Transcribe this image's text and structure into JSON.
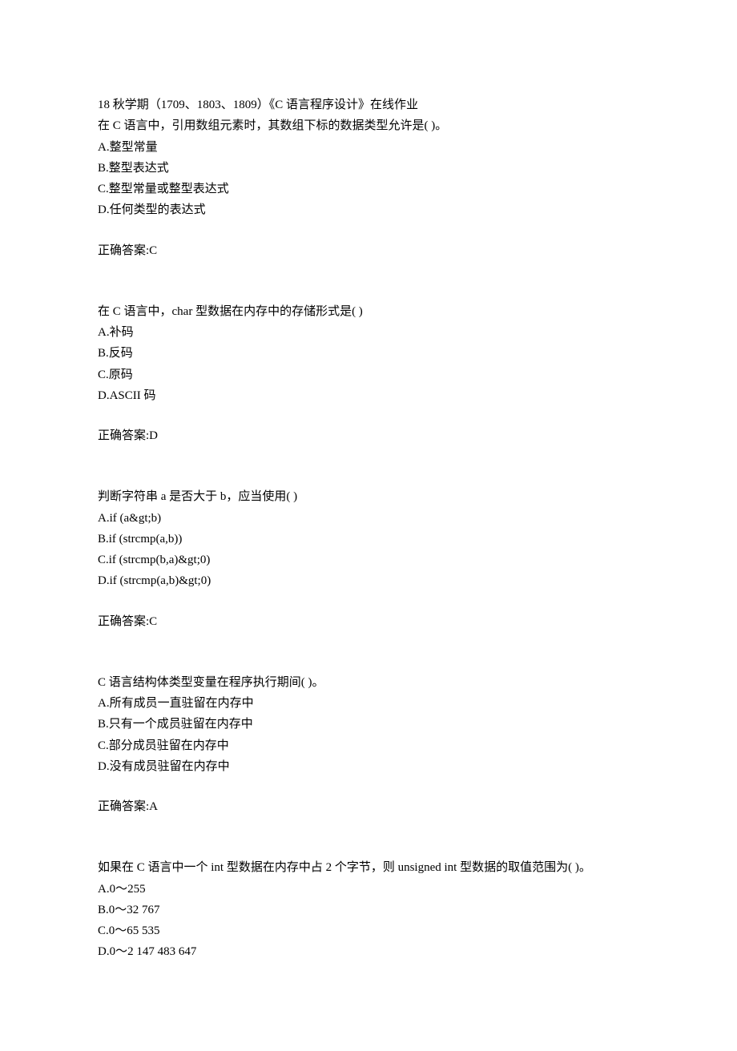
{
  "header": "18 秋学期（1709、1803、1809）《C 语言程序设计》在线作业",
  "questions": [
    {
      "prompt": "在 C 语言中，引用数组元素时，其数组下标的数据类型允许是( )。",
      "options": [
        "A.整型常量",
        "B.整型表达式",
        "C.整型常量或整型表达式",
        "D.任何类型的表达式"
      ],
      "answer": "正确答案:C"
    },
    {
      "prompt": "在 C 语言中，char 型数据在内存中的存储形式是( )",
      "options": [
        "A.补码",
        "B.反码",
        "C.原码",
        "D.ASCII 码"
      ],
      "answer": "正确答案:D"
    },
    {
      "prompt": "判断字符串 a 是否大于 b，应当使用( )",
      "options": [
        "A.if (a&gt;b)",
        "B.if (strcmp(a,b))",
        "C.if (strcmp(b,a)&gt;0)",
        "D.if (strcmp(a,b)&gt;0)"
      ],
      "answer": "正确答案:C"
    },
    {
      "prompt": "C 语言结构体类型变量在程序执行期间( )。",
      "options": [
        "A.所有成员一直驻留在内存中",
        "B.只有一个成员驻留在内存中",
        "C.部分成员驻留在内存中",
        "D.没有成员驻留在内存中"
      ],
      "answer": "正确答案:A"
    },
    {
      "prompt": "如果在 C 语言中一个 int 型数据在内存中占 2 个字节，则 unsigned int 型数据的取值范围为( )。",
      "options": [
        "A.0～255",
        "B.0～32 767",
        "C.0～65 535",
        "D.0～2 147 483 647"
      ],
      "answer": ""
    }
  ]
}
